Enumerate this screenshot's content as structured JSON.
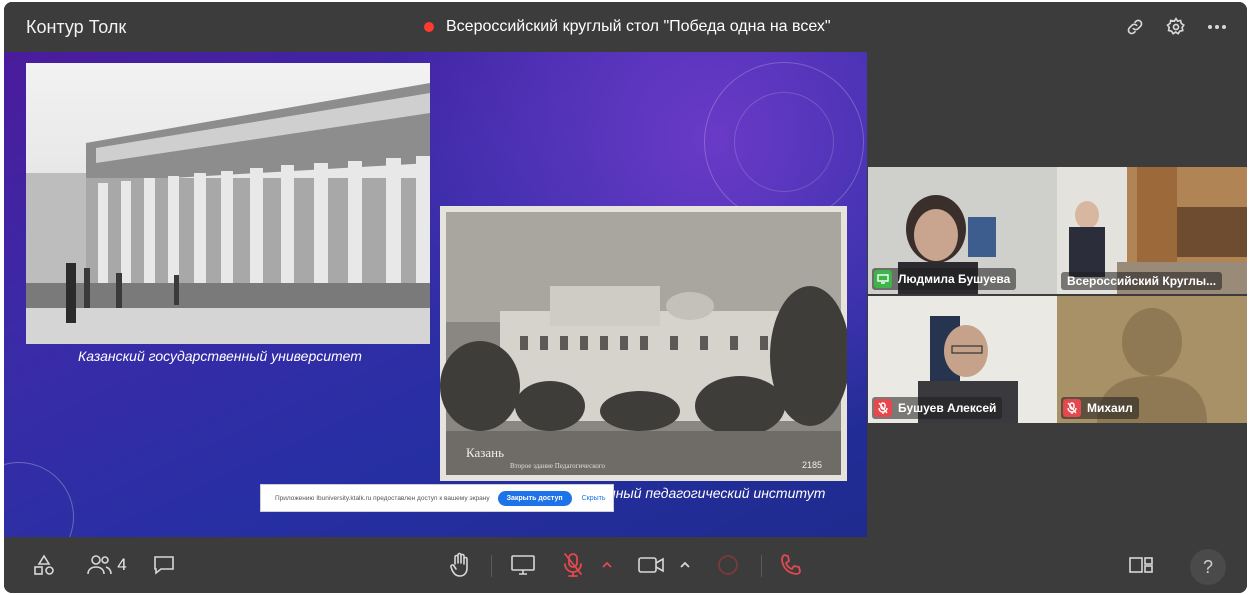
{
  "header": {
    "app_title": "Контур Толк",
    "meeting_title": "Всероссийский круглый стол \"Победа одна на всех\""
  },
  "slide": {
    "caption_left": "Казанский государственный университет",
    "caption_right": "нный педагогический институт",
    "photo_right_label": "Казань",
    "photo_right_sub": "Второе здание Педагогического",
    "photo_right_number": "2185"
  },
  "notice": {
    "text": "Приложению Ibuniversity.ktalk.ru предоставлен доступ к вашему экрану",
    "button": "Закрыть доступ",
    "link": "Скрыть"
  },
  "participants": [
    {
      "name": "Людмила Бушуева",
      "mic": "on"
    },
    {
      "name": "Всероссийский Круглы...",
      "mic": "none"
    },
    {
      "name": "Бушуев Алексей",
      "mic": "muted"
    },
    {
      "name": "Михаил",
      "mic": "muted"
    }
  ],
  "toolbar": {
    "participants_count": "4",
    "help_label": "?"
  },
  "colors": {
    "accent": "#2d9cff",
    "record": "#ff3b30",
    "mic_muted": "#e5484d",
    "end_call": "#e5484d"
  }
}
